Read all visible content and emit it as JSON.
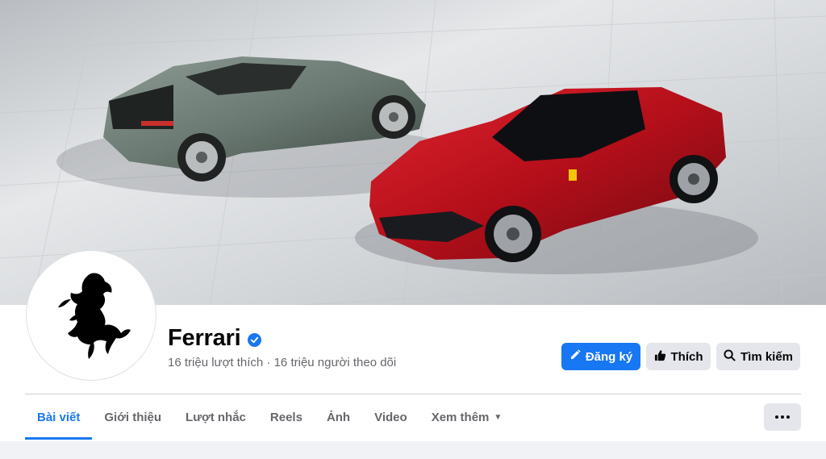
{
  "page": {
    "name": "Ferrari",
    "verified": true,
    "stats": "16 triệu lượt thích · 16 triệu người theo dõi"
  },
  "actions": {
    "subscribe_label": "Đăng ký",
    "like_label": "Thích",
    "search_label": "Tìm kiếm"
  },
  "tabs": [
    {
      "label": "Bài viết",
      "active": true
    },
    {
      "label": "Giới thiệu",
      "active": false
    },
    {
      "label": "Lượt nhắc",
      "active": false
    },
    {
      "label": "Reels",
      "active": false
    },
    {
      "label": "Ảnh",
      "active": false
    },
    {
      "label": "Video",
      "active": false
    },
    {
      "label": "Xem thêm",
      "active": false
    }
  ],
  "colors": {
    "accent": "#1877f2",
    "secondary_button": "#e4e6eb",
    "muted_text": "#65676b"
  },
  "icons": {
    "subscribe": "pencil-icon",
    "like": "thumbs-up-icon",
    "search": "search-icon",
    "more": "more-dots-icon",
    "verified": "verified-badge-icon",
    "dropdown": "caret-down-icon"
  }
}
